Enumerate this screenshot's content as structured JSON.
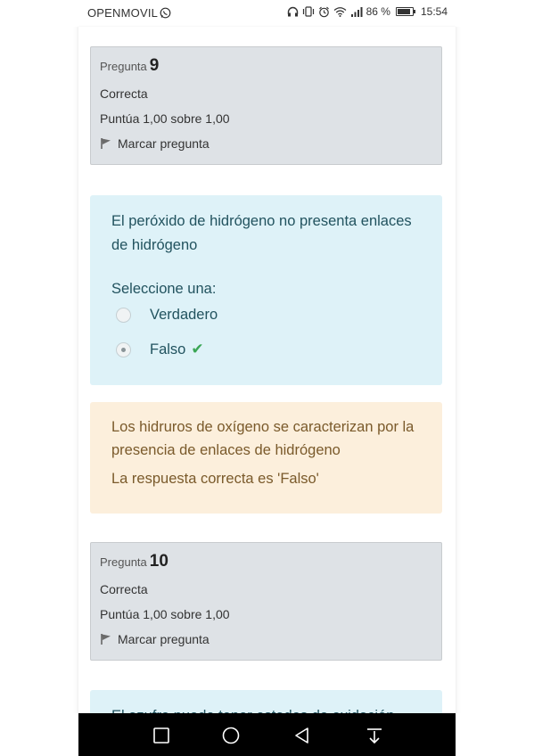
{
  "status_bar": {
    "carrier": "OPENMOVIL",
    "battery": "86 %",
    "battery_level": 0.86,
    "time": "15:54",
    "icons": [
      "whatsapp-icon",
      "headphones-icon",
      "vibrate-icon",
      "alarm-icon",
      "wifi-icon",
      "signal-icon",
      "battery-icon"
    ]
  },
  "questions": [
    {
      "label": "Pregunta",
      "number": "9",
      "state": "Correcta",
      "grade": "Puntúa 1,00 sobre 1,00",
      "flag_label": "Marcar pregunta",
      "text": "El peróxido de hidrógeno no presenta enlaces de hidrógeno",
      "prompt": "Seleccione una:",
      "options": [
        {
          "label": "Verdadero",
          "checked": false
        },
        {
          "label": "Falso",
          "checked": true,
          "correct_mark": "✔"
        }
      ],
      "feedback": "Los hidruros de oxígeno se caracterizan por la presencia de enlaces de hidrógeno",
      "right_answer": "La respuesta correcta es 'Falso'"
    },
    {
      "label": "Pregunta",
      "number": "10",
      "state": "Correcta",
      "grade": "Puntúa 1,00 sobre 1,00",
      "flag_label": "Marcar pregunta",
      "text": "El azufre puede tener estados de oxidación"
    }
  ],
  "colors": {
    "info_bg": "#dee2e6",
    "formulation_bg": "#def2f8",
    "feedback_bg": "#fcefdc",
    "correct_green": "#3aa655"
  },
  "nav_bar": {
    "icons": [
      "recent-apps-icon",
      "home-icon",
      "back-icon",
      "notifications-icon"
    ]
  }
}
